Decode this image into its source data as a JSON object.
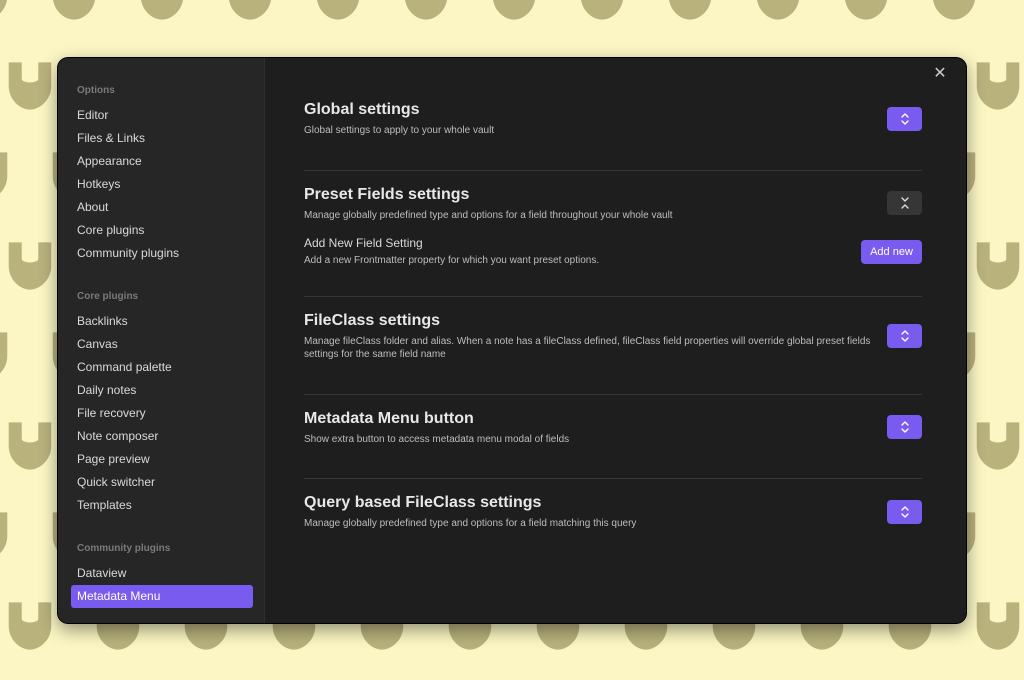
{
  "colors": {
    "background": "#fbf6c3",
    "pattern": "#b9b27d",
    "accent": "#7a5bf0",
    "modal": "#1e1e1e",
    "sidebar": "#262626"
  },
  "sidebar": {
    "groups": [
      {
        "heading": "Options",
        "items": [
          "Editor",
          "Files & Links",
          "Appearance",
          "Hotkeys",
          "About",
          "Core plugins",
          "Community plugins"
        ]
      },
      {
        "heading": "Core plugins",
        "items": [
          "Backlinks",
          "Canvas",
          "Command palette",
          "Daily notes",
          "File recovery",
          "Note composer",
          "Page preview",
          "Quick switcher",
          "Templates"
        ]
      },
      {
        "heading": "Community plugins",
        "items": [
          "Dataview",
          "Metadata Menu"
        ]
      }
    ],
    "active": "Metadata Menu"
  },
  "close_icon": "close-icon",
  "sections": {
    "global": {
      "title": "Global settings",
      "desc": "Global settings to apply to your whole vault"
    },
    "preset": {
      "title": "Preset Fields settings",
      "desc": "Manage globally predefined type and options for a field throughout your whole vault"
    },
    "add_field": {
      "title": "Add New Field Setting",
      "desc": "Add a new Frontmatter property for which you want preset options.",
      "button": "Add new"
    },
    "fileclass": {
      "title": "FileClass settings",
      "desc": "Manage fileClass folder and alias. When a note has a fileClass defined, fileClass field properties will override global preset fields settings for the same field name"
    },
    "menu_button": {
      "title": "Metadata Menu button",
      "desc": "Show extra button to access metadata menu modal of fields"
    },
    "query": {
      "title": "Query based FileClass settings",
      "desc": "Manage globally predefined type and options for a field matching this query"
    }
  }
}
